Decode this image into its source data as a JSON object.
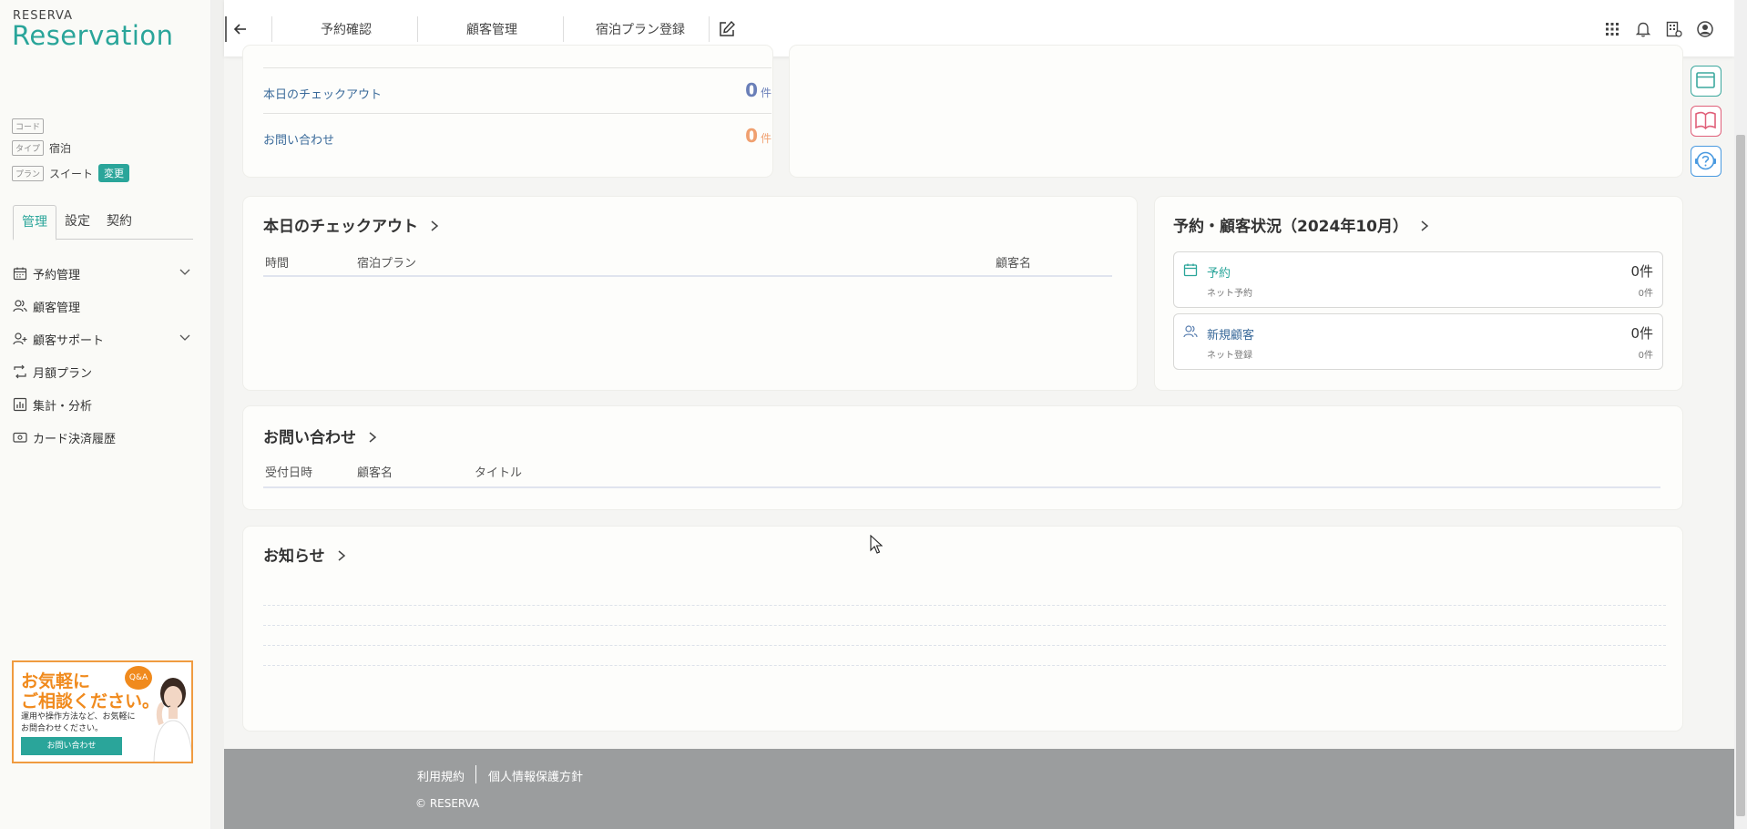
{
  "brand": {
    "small": "RESERVA",
    "big": "Reservation"
  },
  "meta": {
    "code_tag": "コード",
    "type_tag": "タイプ",
    "type_value": "宿泊",
    "plan_tag": "プラン",
    "plan_value": "スイート",
    "change_label": "変更"
  },
  "sidebar_tabs": [
    "管理",
    "設定",
    "契約"
  ],
  "menu": [
    {
      "label": "予約管理",
      "icon": "calendar-icon",
      "expandable": true
    },
    {
      "label": "顧客管理",
      "icon": "users-icon",
      "expandable": false
    },
    {
      "label": "顧客サポート",
      "icon": "user-plus-icon",
      "expandable": true
    },
    {
      "label": "月額プラン",
      "icon": "repeat-icon",
      "expandable": false
    },
    {
      "label": "集計・分析",
      "icon": "chart-icon",
      "expandable": false
    },
    {
      "label": "カード決済履歴",
      "icon": "card-icon",
      "expandable": false
    }
  ],
  "banner": {
    "line1": "お気軽に",
    "line2": "ご相談ください。",
    "sub": "運用や操作方法など、お気軽にお問合わせください。",
    "button": "お問い合わせ",
    "bubble": "Q&A"
  },
  "header": {
    "links": [
      "予約確認",
      "顧客管理",
      "宿泊プラン登録"
    ]
  },
  "stats": [
    {
      "label": "本日のチェックアウト",
      "value": "0",
      "unit": "件",
      "color": "#6a7fb8"
    },
    {
      "label": "お問い合わせ",
      "value": "0",
      "unit": "件",
      "color": "#f0a070"
    }
  ],
  "checkout": {
    "title": "本日のチェックアウト",
    "columns": [
      "時間",
      "宿泊プラン",
      "顧客名"
    ]
  },
  "status": {
    "title": "予約・顧客状況（2024年10月）",
    "boxes": [
      {
        "label": "予約",
        "value": "0件",
        "sub": "ネット予約",
        "subvalue": "0件",
        "icon": "calendar-icon"
      },
      {
        "label": "新規顧客",
        "value": "0件",
        "sub": "ネット登録",
        "subvalue": "0件",
        "icon": "users-icon"
      }
    ]
  },
  "inquiry": {
    "title": "お問い合わせ",
    "columns": [
      "受付日時",
      "顧客名",
      "タイトル"
    ]
  },
  "news": {
    "title": "お知らせ"
  },
  "footer": {
    "links": [
      "利用規約",
      "個人情報保護方針"
    ],
    "copyright": "© RESERVA"
  },
  "colors": {
    "accent": "#2aa59a",
    "footer": "#9b9d9e"
  }
}
